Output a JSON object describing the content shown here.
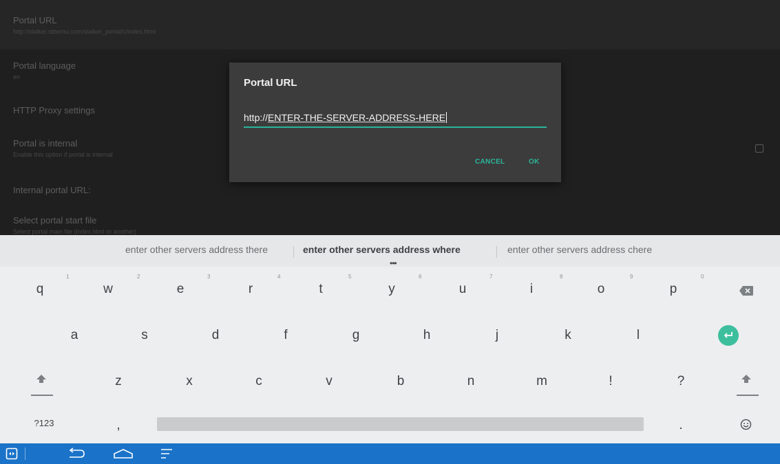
{
  "settings": {
    "items": [
      {
        "title": "Portal URL",
        "subtitle": "http://stalker.stbemu.com/stalker_portal/c/index.html"
      },
      {
        "title": "Portal language",
        "subtitle": "en"
      },
      {
        "title": "HTTP Proxy settings",
        "subtitle": ""
      },
      {
        "title": "Portal is internal",
        "subtitle": "Enable this option if portal is internal"
      },
      {
        "title": "Internal portal URL:",
        "subtitle": ""
      },
      {
        "title": "Select portal start file",
        "subtitle": "Select portal main file (index.html or another)"
      }
    ],
    "portal_internal_checked": false
  },
  "dialog": {
    "title": "Portal URL",
    "input_prefix": "http://",
    "input_value": "ENTER-THE-SERVER-ADDRESS-HERE",
    "cancel_label": "CANCEL",
    "ok_label": "OK",
    "accent_color": "#2bb59a"
  },
  "keyboard": {
    "suggestions": [
      "enter other servers address there",
      "enter other servers address where",
      "enter other servers address chere"
    ],
    "suggestion_dots": "•••",
    "row1": [
      "q",
      "w",
      "e",
      "r",
      "t",
      "y",
      "u",
      "i",
      "o",
      "p"
    ],
    "row1_hints": [
      "1",
      "2",
      "3",
      "4",
      "5",
      "6",
      "7",
      "8",
      "9",
      "0"
    ],
    "row2": [
      "a",
      "s",
      "d",
      "f",
      "g",
      "h",
      "j",
      "k",
      "l"
    ],
    "row3": [
      "z",
      "x",
      "c",
      "v",
      "b",
      "n",
      "m",
      "!",
      "?"
    ],
    "row4": {
      "symbols": "?123",
      "comma": ",",
      "period": "."
    },
    "icons": [
      "backspace-icon",
      "enter-icon",
      "shift-left-icon",
      "shift-right-icon",
      "emoji-icon"
    ]
  },
  "navbar": {
    "color": "#1a73c9",
    "icons": [
      "app-switch-icon",
      "back-icon",
      "home-icon",
      "menu-icon"
    ]
  }
}
